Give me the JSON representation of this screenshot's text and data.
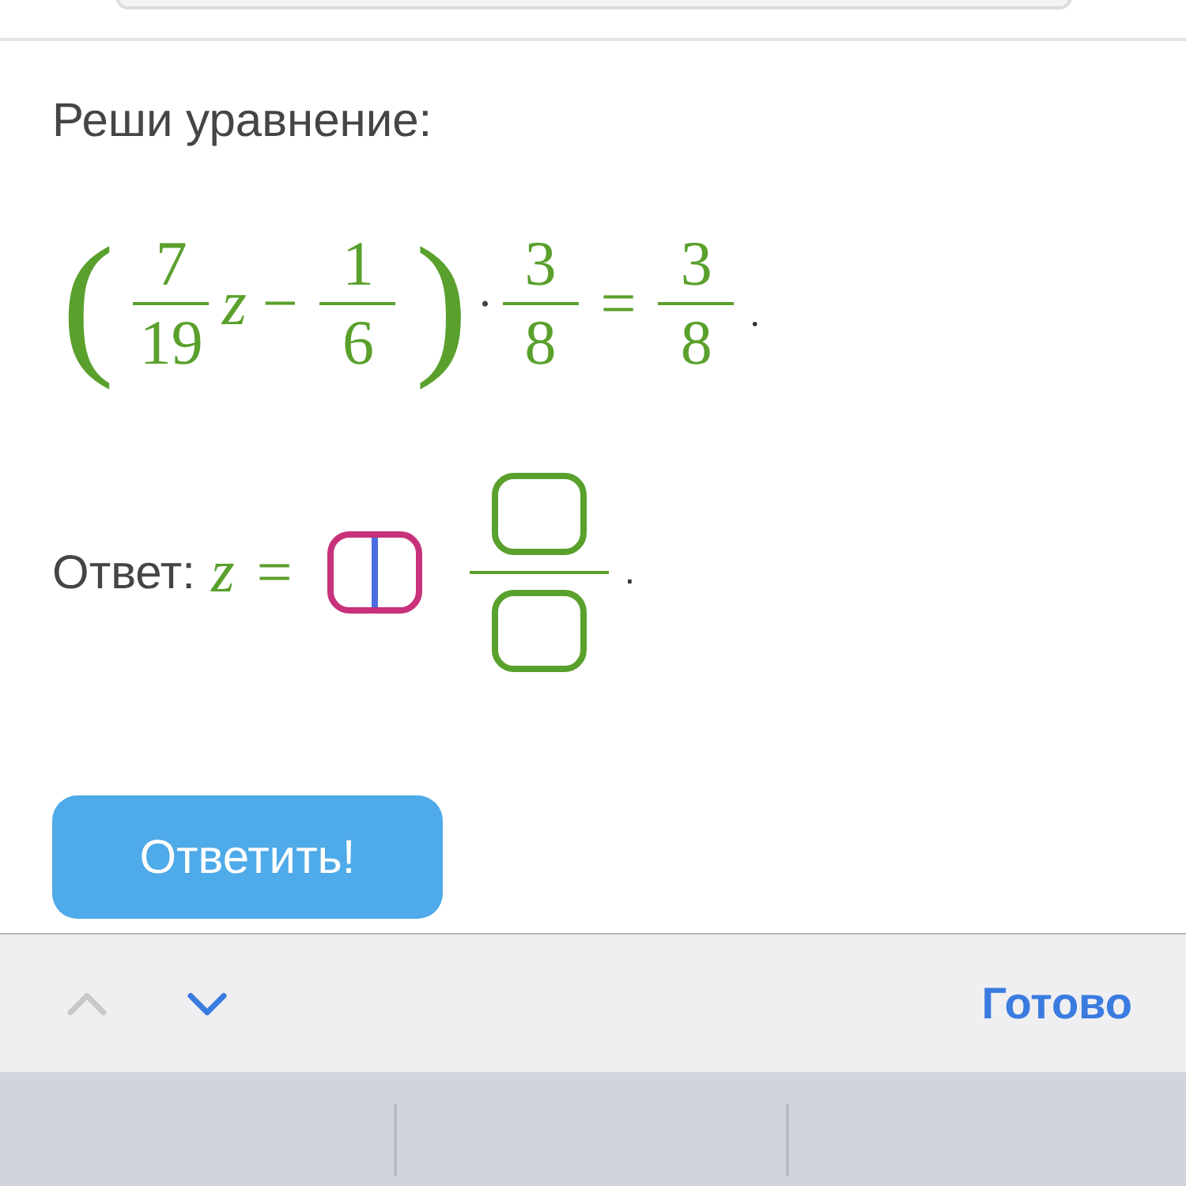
{
  "prompt": "Реши уравнение:",
  "equation": [
    {
      "kind": "paren",
      "text": "("
    },
    {
      "kind": "frac",
      "num": "7",
      "den": "19"
    },
    {
      "kind": "var",
      "text": "z"
    },
    {
      "kind": "op",
      "text": "−"
    },
    {
      "kind": "frac",
      "num": "1",
      "den": "6"
    },
    {
      "kind": "paren",
      "text": ")"
    },
    {
      "kind": "dot",
      "text": "·"
    },
    {
      "kind": "frac",
      "num": "3",
      "den": "8"
    },
    {
      "kind": "op",
      "text": "="
    },
    {
      "kind": "frac",
      "num": "3",
      "den": "8"
    },
    {
      "kind": "punct",
      "text": "."
    }
  ],
  "answer": {
    "label": "Ответ:",
    "variable": "z",
    "equals": "=",
    "whole_field": {
      "focused": true
    },
    "numerator_field": {
      "focused": false
    },
    "denominator_field": {
      "focused": false
    },
    "period": "."
  },
  "submit_button": "Ответить!",
  "keyboard_toolbar": {
    "previous": {
      "disabled": true
    },
    "next": {
      "disabled": false
    },
    "done": "Готово"
  }
}
